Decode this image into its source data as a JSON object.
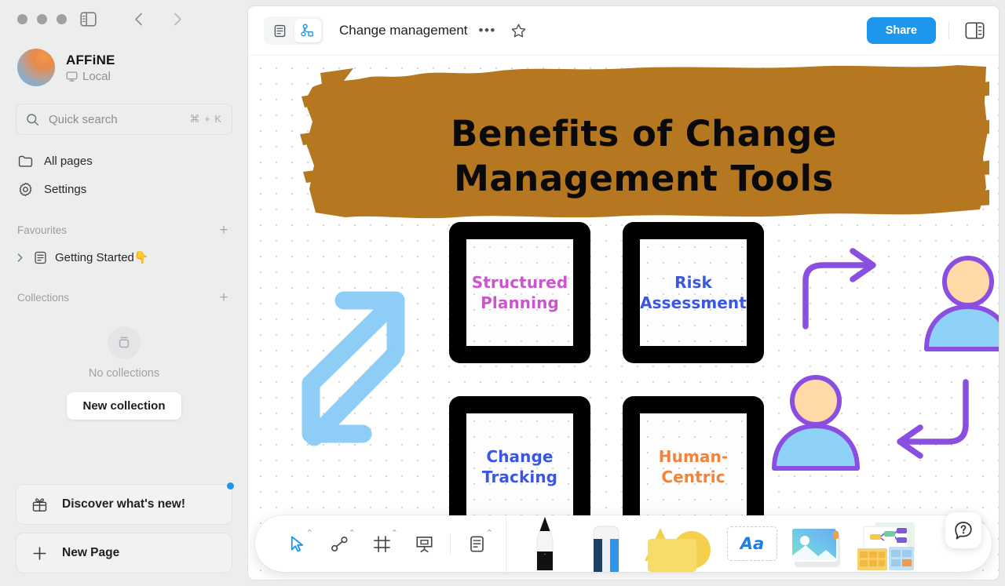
{
  "window": {
    "traffic_lights": [
      "close",
      "minimize",
      "maximize"
    ],
    "sidebar_toggle_icon": "sidebar-toggle-icon",
    "back_icon": "chevron-left-icon",
    "forward_icon": "chevron-right-icon"
  },
  "sidebar": {
    "workspace": {
      "name": "AFFiNE",
      "sync_status": "Local",
      "sync_icon": "desktop-icon",
      "avatar_icon": "workspace-avatar"
    },
    "search": {
      "placeholder": "Quick search",
      "shortcut": "⌘ + K",
      "icon": "search-icon"
    },
    "nav_items": [
      {
        "label": "All pages",
        "icon": "folder-icon"
      },
      {
        "label": "Settings",
        "icon": "gear-icon"
      }
    ],
    "favourites": {
      "title": "Favourites",
      "add_label": "+",
      "items": [
        {
          "label": "Getting Started👇",
          "icon": "doc-icon",
          "expand_icon": "chevron-right-icon"
        }
      ]
    },
    "collections": {
      "title": "Collections",
      "add_label": "+",
      "empty_text": "No collections",
      "empty_icon": "collection-icon",
      "new_button": "New collection"
    },
    "bottom_buttons": [
      {
        "label": "Discover what's new!",
        "icon": "gift-icon",
        "has_badge": true
      },
      {
        "label": "New Page",
        "icon": "plus-icon",
        "has_badge": false
      }
    ]
  },
  "header": {
    "mode_page_icon": "page-mode-icon",
    "mode_edgeless_icon": "edgeless-mode-icon",
    "active_mode": "edgeless",
    "title": "Change management",
    "more_label": "•••",
    "star_icon": "star-icon",
    "share_label": "Share",
    "right_panel_icon": "right-sidebar-icon",
    "accent_color": "#1e96eb"
  },
  "canvas": {
    "banner": {
      "line1": "Benefits of Change",
      "line2": "Management Tools",
      "brush_color": "#b5771f",
      "text_color": "#0a0a0a"
    },
    "cards": [
      {
        "label": "Structured\nPlanning",
        "line1": "Structured",
        "line2": "Planning",
        "color": "#cc55cc"
      },
      {
        "label": "Risk\nAssessment",
        "line1": "Risk",
        "line2": "Assessment",
        "color": "#3b56e0"
      },
      {
        "label": "Change\nTracking",
        "line1": "Change",
        "line2": "Tracking",
        "color": "#3b56e0"
      },
      {
        "label": "Human-\nCentric",
        "line1": "Human-",
        "line2": "Centric",
        "color": "#f2833c"
      }
    ],
    "decorations": [
      {
        "name": "double-arrow-diagonal",
        "color": "#8ecdf5"
      },
      {
        "name": "curved-arrow-right",
        "color": "#8a4fe0"
      },
      {
        "name": "curved-arrow-left",
        "color": "#8a4fe0"
      },
      {
        "name": "person-figure-top",
        "head_color": "#ffd9a8",
        "body_color": "#8fd2f7",
        "outline": "#8a4fe0"
      },
      {
        "name": "person-figure-bottom",
        "head_color": "#ffd9a8",
        "body_color": "#8fd2f7",
        "outline": "#8a4fe0"
      }
    ]
  },
  "toolbar": {
    "items": [
      {
        "name": "select-tool",
        "icon": "cursor-icon",
        "active": true,
        "has_caret": true
      },
      {
        "name": "connector-tool",
        "icon": "connector-icon",
        "active": false,
        "has_caret": true
      },
      {
        "name": "frame-tool",
        "icon": "frame-icon",
        "active": false,
        "has_caret": true
      },
      {
        "name": "present-tool",
        "icon": "present-icon",
        "active": false,
        "has_caret": false
      },
      {
        "name": "note-tool",
        "icon": "note-icon",
        "active": false,
        "has_caret": true
      }
    ],
    "media_items": [
      {
        "name": "pen-tool",
        "icon": "pencil-icon"
      },
      {
        "name": "eraser-tool",
        "icon": "eraser-icon"
      },
      {
        "name": "shape-tool",
        "icon": "shapes-icon"
      },
      {
        "name": "text-tool",
        "icon": "text-icon",
        "label": "Aa"
      },
      {
        "name": "image-tool",
        "icon": "image-icon"
      },
      {
        "name": "template-tool",
        "icon": "template-icon"
      }
    ],
    "help_label": "?",
    "help_icon": "help-icon"
  }
}
